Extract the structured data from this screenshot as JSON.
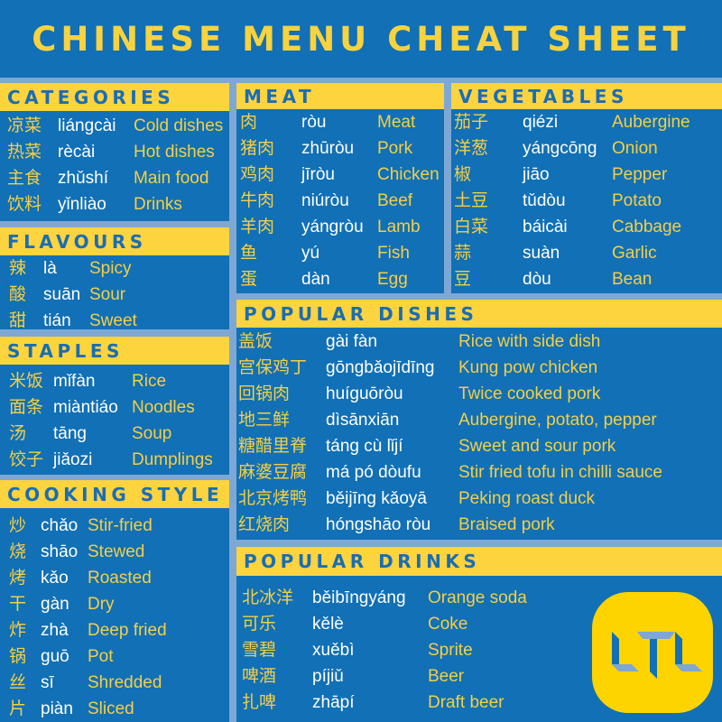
{
  "title": "CHINESE MENU CHEAT SHEET",
  "colors": {
    "background": "#1170b6",
    "header": "#fdd43e",
    "accent_text": "#f5cf45",
    "pinyin": "#ffffff",
    "gap": "#7fa7d3"
  },
  "sections": {
    "categories": {
      "title": "CATEGORIES",
      "rows": [
        [
          "凉菜",
          "liángcài",
          "Cold dishes"
        ],
        [
          "热菜",
          "rècài",
          "Hot dishes"
        ],
        [
          "主食",
          "zhǔshí",
          "Main food"
        ],
        [
          "饮料",
          "yǐnliào",
          "Drinks"
        ]
      ]
    },
    "flavours": {
      "title": "FLAVOURS",
      "rows": [
        [
          "辣",
          "là",
          "Spicy"
        ],
        [
          "酸",
          "suān",
          "Sour"
        ],
        [
          "甜",
          "tián",
          "Sweet"
        ]
      ]
    },
    "staples": {
      "title": "STAPLES",
      "rows": [
        [
          "米饭",
          "mǐfàn",
          "Rice"
        ],
        [
          "面条",
          "miàntiáo",
          "Noodles"
        ],
        [
          "汤",
          "tāng",
          "Soup"
        ],
        [
          "饺子",
          "jiǎozi",
          "Dumplings"
        ]
      ]
    },
    "cooking": {
      "title": "COOKING STYLE",
      "rows": [
        [
          "炒",
          "chǎo",
          "Stir-fried"
        ],
        [
          "烧",
          "shāo",
          "Stewed"
        ],
        [
          "烤",
          "kǎo",
          "Roasted"
        ],
        [
          "干",
          "gàn",
          "Dry"
        ],
        [
          "炸",
          "zhà",
          "Deep fried"
        ],
        [
          "锅",
          "guō",
          "Pot"
        ],
        [
          "丝",
          "sī",
          "Shredded"
        ],
        [
          "片",
          "piàn",
          "Sliced"
        ]
      ]
    },
    "meat": {
      "title": "MEAT",
      "rows": [
        [
          "肉",
          "ròu",
          "Meat"
        ],
        [
          "猪肉",
          "zhūròu",
          "Pork"
        ],
        [
          "鸡肉",
          "jīròu",
          "Chicken"
        ],
        [
          "牛肉",
          "niúròu",
          "Beef"
        ],
        [
          "羊肉",
          "yángròu",
          "Lamb"
        ],
        [
          "鱼",
          "yú",
          "Fish"
        ],
        [
          "蛋",
          "dàn",
          "Egg"
        ]
      ]
    },
    "vegetables": {
      "title": "VEGETABLES",
      "rows": [
        [
          "茄子",
          "qiézi",
          "Aubergine"
        ],
        [
          "洋葱",
          "yángcōng",
          "Onion"
        ],
        [
          "椒",
          "jiāo",
          "Pepper"
        ],
        [
          "土豆",
          "tǔdòu",
          "Potato"
        ],
        [
          "白菜",
          "báicài",
          "Cabbage"
        ],
        [
          "蒜",
          "suàn",
          "Garlic"
        ],
        [
          "豆",
          "dòu",
          "Bean"
        ]
      ]
    },
    "dishes": {
      "title": "POPULAR DISHES",
      "rows": [
        [
          "盖饭",
          "gài fàn",
          "Rice with side dish"
        ],
        [
          "宫保鸡丁",
          "gōngbǎojīdīng",
          "Kung pow chicken"
        ],
        [
          "回锅肉",
          "huíguōròu",
          "Twice cooked pork"
        ],
        [
          "地三鲜",
          "dìsānxiān",
          "Aubergine, potato, pepper"
        ],
        [
          "糖醋里脊",
          "táng cù lǐjí",
          "Sweet and sour pork"
        ],
        [
          "麻婆豆腐",
          "má pó dòufu",
          "Stir fried tofu in chilli sauce"
        ],
        [
          "北京烤鸭",
          "běijīng kǎoyā",
          "Peking roast duck"
        ],
        [
          "红烧肉",
          "hóngshāo ròu",
          "Braised pork"
        ]
      ]
    },
    "drinks": {
      "title": "POPULAR DRINKS",
      "rows": [
        [
          "北冰洋",
          "běibīngyáng",
          "Orange soda"
        ],
        [
          "可乐",
          "kělè",
          "Coke"
        ],
        [
          "雪碧",
          "xuěbì",
          "Sprite"
        ],
        [
          "啤酒",
          "píjiǔ",
          "Beer"
        ],
        [
          "扎啤",
          "zhāpí",
          "Draft beer"
        ]
      ]
    }
  },
  "logo": {
    "text": "LTL"
  }
}
